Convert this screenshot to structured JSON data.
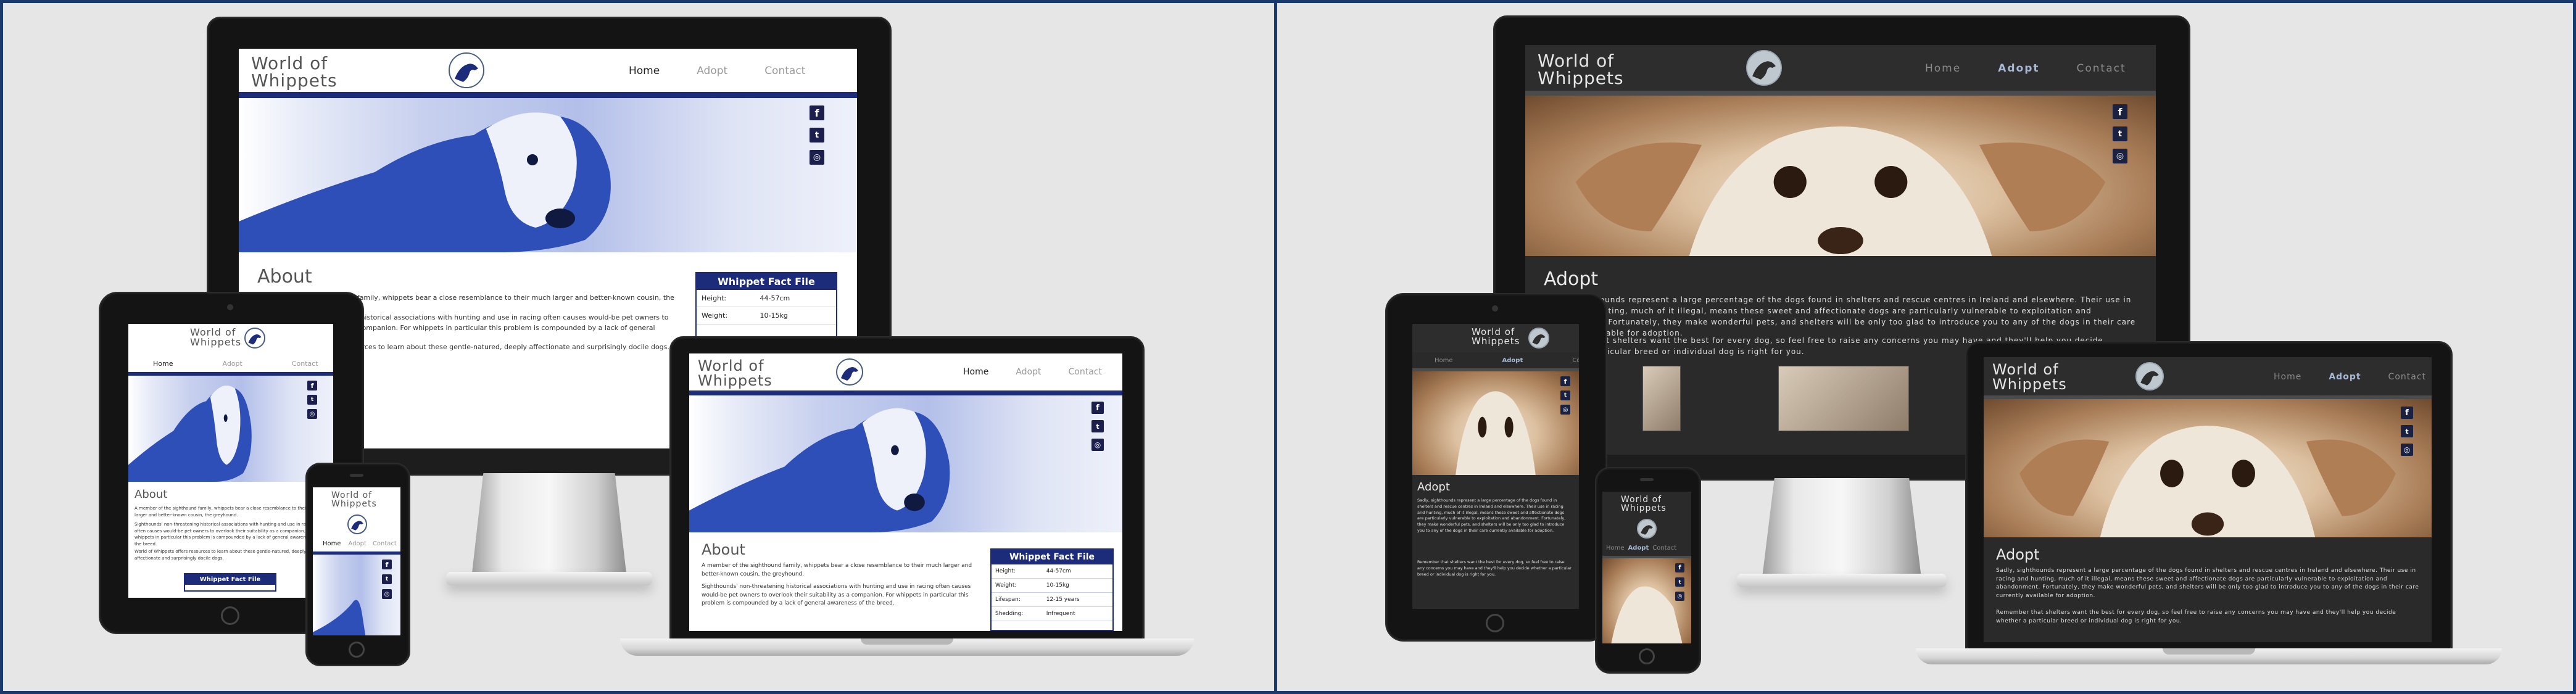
{
  "site": {
    "logo_line1": "World of",
    "logo_line2": "Whippets",
    "nav": [
      "Home",
      "Adopt",
      "Contact"
    ],
    "social_icons": [
      "facebook-icon",
      "twitter-icon",
      "instagram-icon"
    ]
  },
  "home": {
    "about_title": "About",
    "intro": "A member of the sighthound family, whippets bear a close resemblance to their much larger and better-known cousin, the greyhound.",
    "body": "Sighthounds' non-threatening historical associations with hunting and use in racing often causes would-be pet owners to overlook their suitability as a companion. For whippets in particular this problem is compounded by a lack of general awareness of the breed.",
    "outro": "World of Whippets offers resources to learn about these gentle-natured, deeply affectionate and surprisingly docile dogs.",
    "fact_file": {
      "title": "Whippet Fact File",
      "rows": [
        {
          "label": "Height:",
          "value": "44-57cm"
        },
        {
          "label": "Weight:",
          "value": "10-15kg"
        },
        {
          "label": "Lifespan:",
          "value": "12-15 years"
        },
        {
          "label": "Shedding:",
          "value": "Infrequent"
        }
      ]
    }
  },
  "adopt": {
    "title": "Adopt",
    "p1": "Sadly, sighthounds represent a large percentage of the dogs found in shelters and rescue centres in Ireland and elsewhere. Their use in racing and hunting, much of it illegal, means these sweet and affectionate dogs are particularly vulnerable to exploitation and abandonment. Fortunately, they make wonderful pets, and shelters will be only too glad to introduce you to any of the dogs in their care currently available for adoption.",
    "p2": "Remember that shelters want the best for every dog, so feel free to raise any concerns you may have and they'll help you decide whether a particular breed or individual dog is right for you."
  },
  "colors": {
    "brand_navy": "#1c2b7a",
    "panel_border": "#1a3a6e",
    "dark_bg": "#2a2a2a",
    "active_nav_dark": "#a6bad6"
  }
}
